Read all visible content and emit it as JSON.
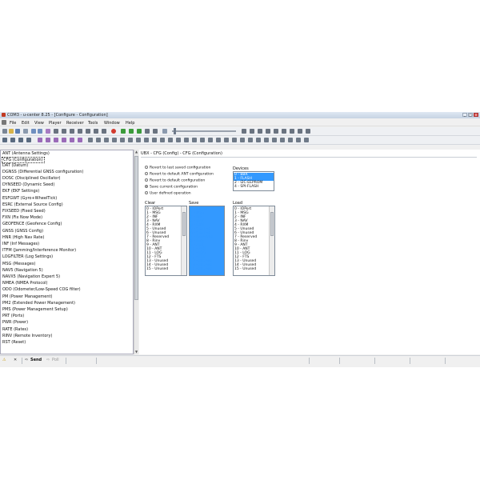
{
  "window": {
    "title": "COM3 - u-center 8.25 - [Configure - Configuration]",
    "menu": [
      "File",
      "Edit",
      "View",
      "Player",
      "Receiver",
      "Tools",
      "Window",
      "Help"
    ]
  },
  "messages": [
    "ANT (Antenna Settings)",
    "CFG (Configuration)",
    "DAT (Datum)",
    "DGNSS (Differential GNSS configuration)",
    "DOSC (Disciplined Oscillator)",
    "DYNSEED (Dynamic Seed)",
    "EKF (EKF Settings)",
    "ESFGWT (Gyro+WheelTick)",
    "ESRC (External Source Config)",
    "FIXSEED (Fixed Seed)",
    "FXN (Fix Now Mode)",
    "GEOFENCE (Geofence Config)",
    "GNSS (GNSS Config)",
    "HNR (High Nav Rate)",
    "INF (Inf Messages)",
    "ITFM (Jamming/Interference Monitor)",
    "LOGFILTER (Log Settings)",
    "MSG (Messages)",
    "NAV5 (Navigation 5)",
    "NAVX5 (Navigation Expert 5)",
    "NMEA (NMEA Protocol)",
    "ODO (Odometer/Low-Speed COG filter)",
    "PM (Power Management)",
    "PM2 (Extended Power Management)",
    "PMS (Power Management Setup)",
    "PRT (Ports)",
    "PWR (Power)",
    "RATE (Rates)",
    "RINV (Remote Inventory)",
    "RST (Reset)"
  ],
  "selected_message": "CFG (Configuration)",
  "panel": {
    "header": "UBX - CFG (Config) - CFG (Configuration)",
    "options": [
      "Revert to last saved configuration",
      "Revert to default ANT configuration",
      "Revert to default configuration",
      "Save current configuration",
      "User defined operation"
    ],
    "selected_option": "Save current configuration",
    "devices_label": "Devices",
    "devices": [
      "0 - BBR",
      "1 - FLASH",
      "2 - I2C-EEPROM",
      "4 - SPI-FLASH"
    ],
    "devices_selected": [
      "0 - BBR",
      "1 - FLASH"
    ],
    "clear_label": "Clear",
    "save_label": "Save",
    "load_label": "Load",
    "sections": [
      "0 - IOPort",
      "1 - MSG",
      "2 - INF",
      "3 - NAV",
      "4 - RXM",
      "5 - Unused",
      "6 - Unused",
      "7 - Reserved",
      "8 - Rinv",
      "9 - ANT",
      "10 - ANT",
      "11 - LOG",
      "12 - FTS",
      "13 - Unused",
      "14 - Unused",
      "15 - Unused"
    ]
  },
  "statusbar": {
    "send": "Send",
    "poll": "Poll"
  }
}
